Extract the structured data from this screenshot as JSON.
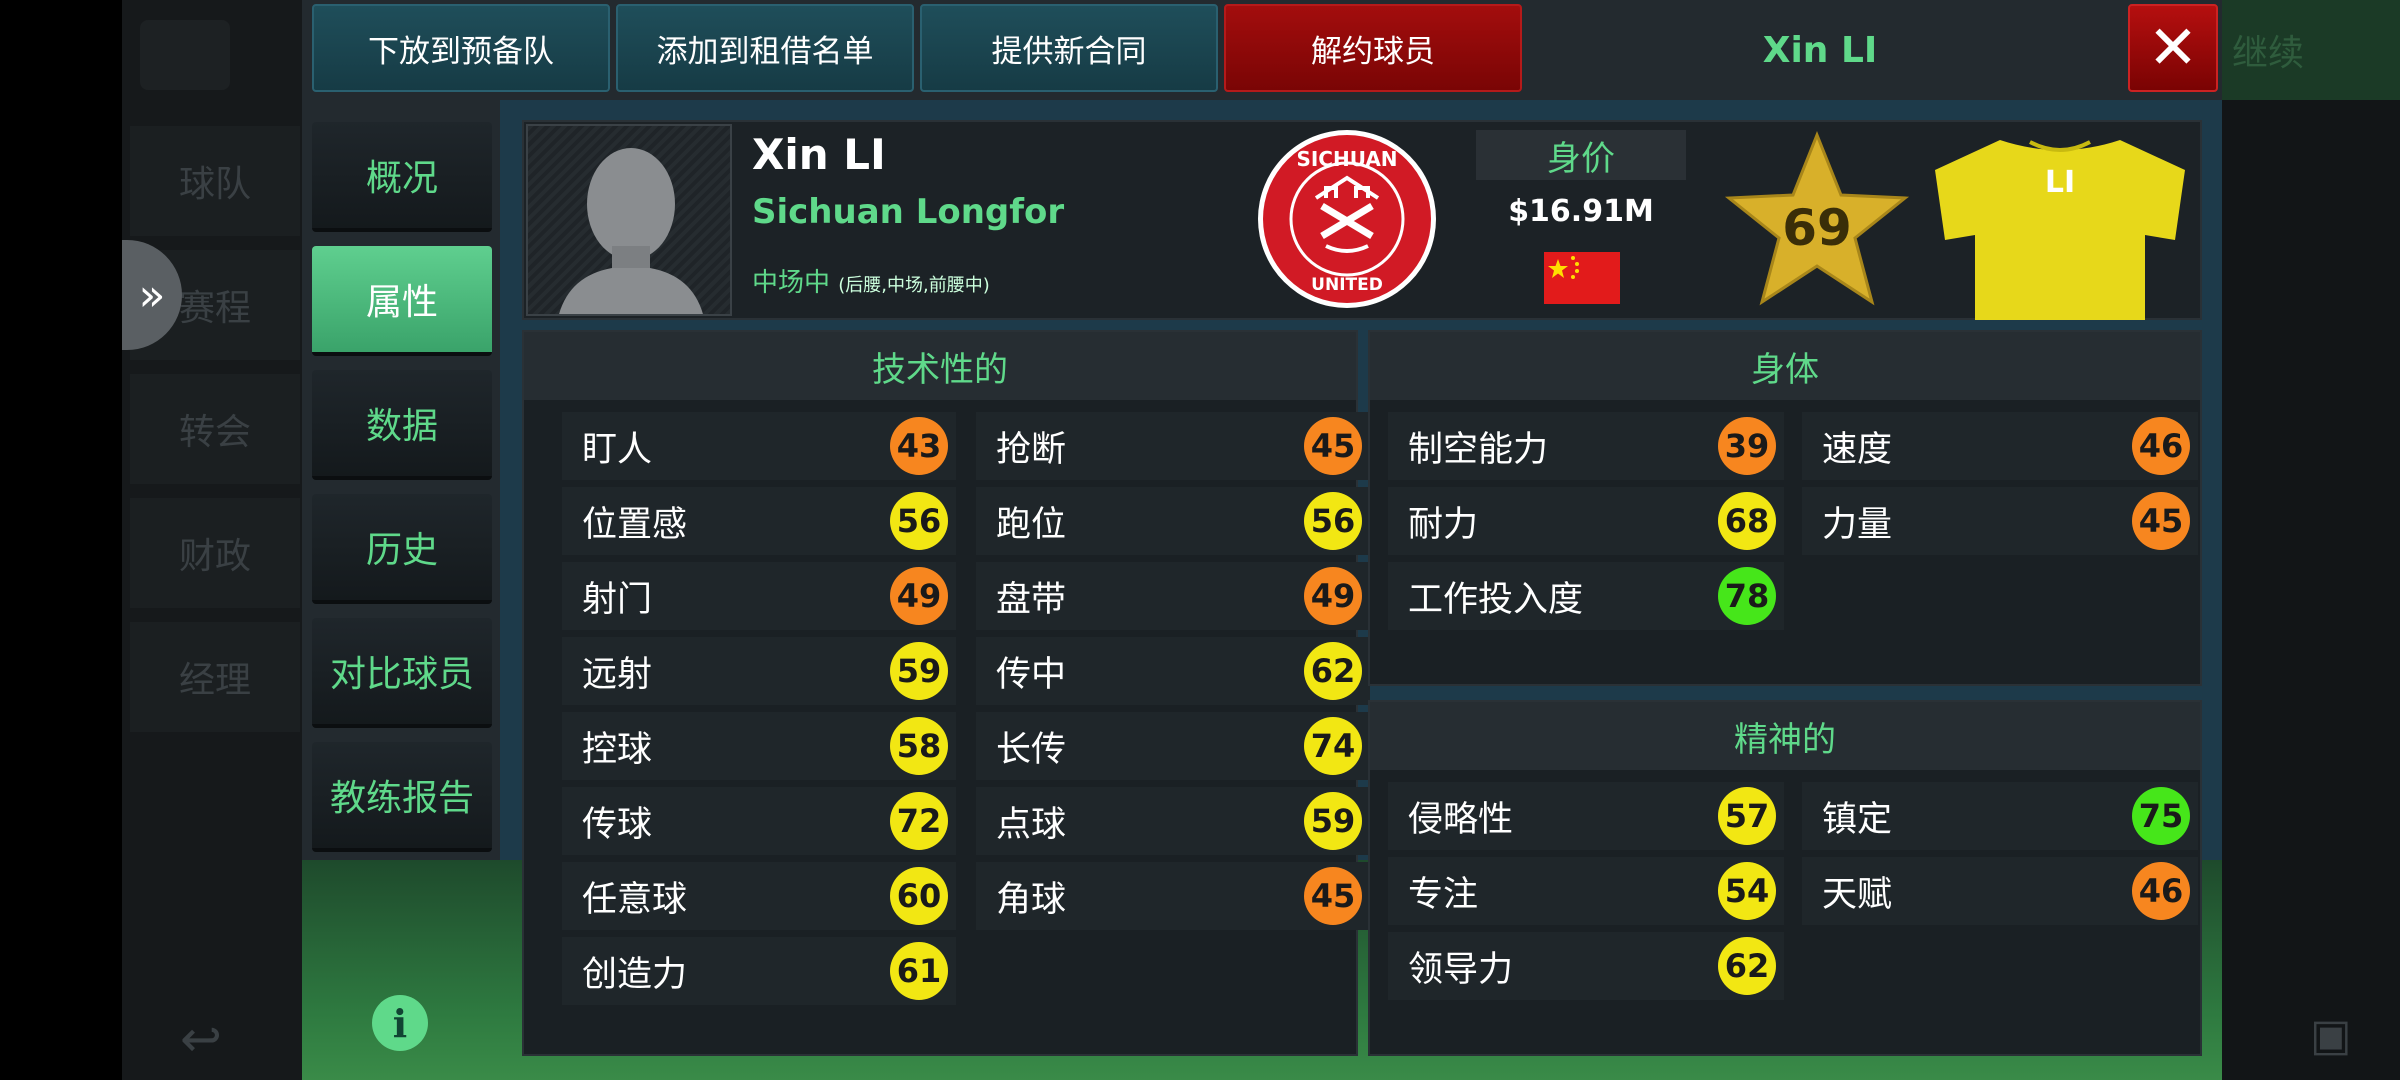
{
  "background": {
    "nav_items": [
      "球队",
      "赛程",
      "转会",
      "财政",
      "经理"
    ],
    "topright_label": "继续"
  },
  "toolbar": {
    "release_to_reserves": "下放到预备队",
    "add_to_loan_list": "添加到租借名单",
    "offer_new_contract": "提供新合同",
    "terminate_player": "解约球员",
    "player_name": "Xin LI"
  },
  "side_tabs": [
    "概况",
    "属性",
    "数据",
    "历史",
    "对比球员",
    "教练报告"
  ],
  "active_tab": "属性",
  "player": {
    "name": "Xin LI",
    "club": "Sichuan Longfor",
    "position": "中场中",
    "position_detail": "(后腰,中场,前腰中)",
    "value_label": "身价",
    "value": "$16.91M",
    "rating": "69",
    "shirt_name": "LI",
    "badge_top": "SICHUAN",
    "badge_bottom": "UNITED",
    "flag": "china"
  },
  "colors": {
    "accent_green": "#5fd98a",
    "rating_orange": "#f7861f",
    "rating_yellow": "#f2e713",
    "rating_green": "#46e61a",
    "terminate_red": "#a30d0d"
  },
  "technical": {
    "title": "技术性的",
    "left": [
      {
        "label": "盯人",
        "value": "43",
        "color": "orange"
      },
      {
        "label": "位置感",
        "value": "56",
        "color": "yellow"
      },
      {
        "label": "射门",
        "value": "49",
        "color": "orange"
      },
      {
        "label": "远射",
        "value": "59",
        "color": "yellow"
      },
      {
        "label": "控球",
        "value": "58",
        "color": "yellow"
      },
      {
        "label": "传球",
        "value": "72",
        "color": "yellow"
      },
      {
        "label": "任意球",
        "value": "60",
        "color": "yellow"
      },
      {
        "label": "创造力",
        "value": "61",
        "color": "yellow"
      }
    ],
    "right": [
      {
        "label": "抢断",
        "value": "45",
        "color": "orange"
      },
      {
        "label": "跑位",
        "value": "56",
        "color": "yellow"
      },
      {
        "label": "盘带",
        "value": "49",
        "color": "orange"
      },
      {
        "label": "传中",
        "value": "62",
        "color": "yellow"
      },
      {
        "label": "长传",
        "value": "74",
        "color": "yellow"
      },
      {
        "label": "点球",
        "value": "59",
        "color": "yellow"
      },
      {
        "label": "角球",
        "value": "45",
        "color": "orange"
      }
    ]
  },
  "physical": {
    "title": "身体",
    "left": [
      {
        "label": "制空能力",
        "value": "39",
        "color": "orange"
      },
      {
        "label": "耐力",
        "value": "68",
        "color": "yellow"
      },
      {
        "label": "工作投入度",
        "value": "78",
        "color": "green"
      }
    ],
    "right": [
      {
        "label": "速度",
        "value": "46",
        "color": "orange"
      },
      {
        "label": "力量",
        "value": "45",
        "color": "orange"
      }
    ]
  },
  "mental": {
    "title": "精神的",
    "left": [
      {
        "label": "侵略性",
        "value": "57",
        "color": "yellow"
      },
      {
        "label": "专注",
        "value": "54",
        "color": "yellow"
      },
      {
        "label": "领导力",
        "value": "62",
        "color": "yellow"
      }
    ],
    "right": [
      {
        "label": "镇定",
        "value": "75",
        "color": "green"
      },
      {
        "label": "天赋",
        "value": "46",
        "color": "orange"
      }
    ]
  }
}
